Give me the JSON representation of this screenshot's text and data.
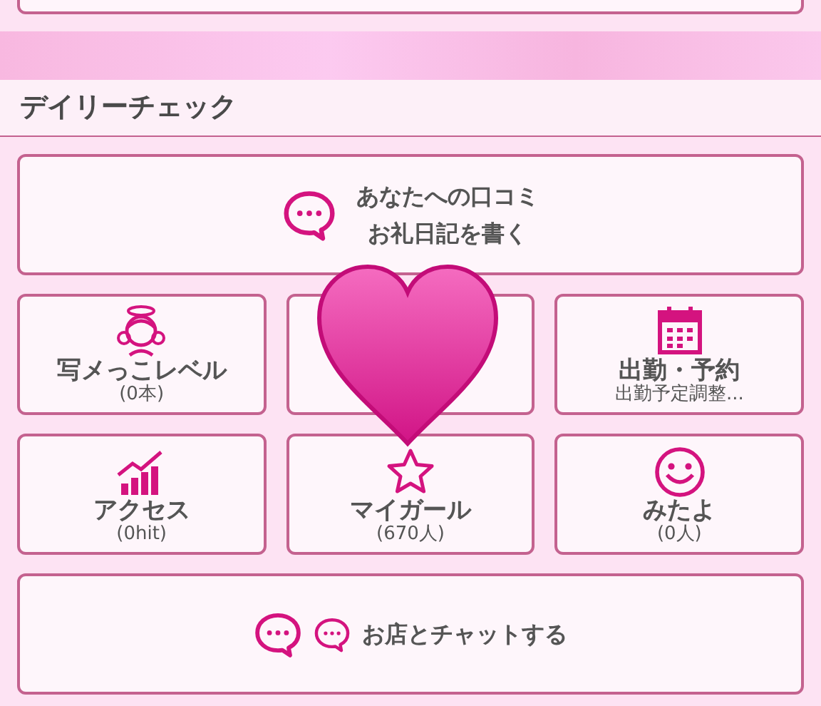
{
  "header": {
    "title": "デイリーチェック"
  },
  "review_button": {
    "lines": [
      "あなたへの口コミ",
      "お礼日記を書く"
    ]
  },
  "tiles": [
    {
      "kind": "angel",
      "label": "写メっこレベル",
      "sub": "(0本)"
    },
    {
      "kind": "covered"
    },
    {
      "kind": "calendar",
      "label": "出勤・予約",
      "sub": "出勤予定調整..."
    },
    {
      "kind": "chart",
      "label": "アクセス",
      "sub": "(0hit)"
    },
    {
      "kind": "star",
      "label": "マイガール",
      "sub": "(670人)"
    },
    {
      "kind": "smile",
      "label": "みたよ",
      "sub": "(0人)"
    }
  ],
  "chat_button": {
    "label": "お店とチャットする"
  },
  "sticker": {
    "kind": "heart"
  }
}
